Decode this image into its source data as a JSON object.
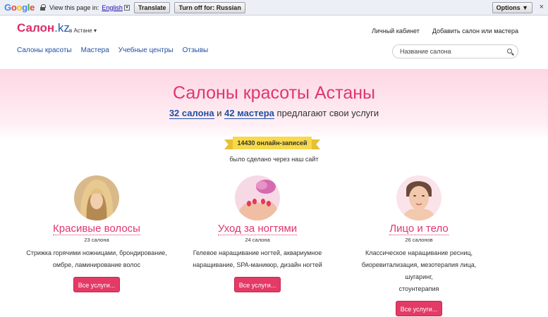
{
  "translate_bar": {
    "logo": "Google",
    "text": "View this page in:",
    "language": "English",
    "translate_label": "Translate",
    "turn_off_label": "Turn off for: Russian",
    "options_label": "Options ▼",
    "close": "×"
  },
  "header": {
    "logo_main": "Салон",
    "logo_domain": ".kz",
    "city": "в Астане",
    "city_arrow": "▾",
    "links": [
      "Личный кабинет",
      "Добавить салон или мастера"
    ],
    "nav": [
      "Салоны красоты",
      "Мастера",
      "Учебные центры",
      "Отзывы"
    ],
    "search_placeholder": "Название салона"
  },
  "hero": {
    "title": "Салоны красоты Астаны",
    "salons_link": "32 салона",
    "and": "и",
    "masters_link": "42 мастера",
    "suffix": "предлагают свои услуги",
    "ribbon": "14430 онлайн-записей",
    "done_text": "было сделано через наш сайт"
  },
  "categories": [
    {
      "title": "Красивые волосы",
      "count": "23 салона",
      "desc1": "Стрижка горячими ножницами, брондирование,",
      "desc2": "омбре, ламинирование волос",
      "desc3": "",
      "button": "Все услуги..."
    },
    {
      "title": "Уход за ногтями",
      "count": "24 салона",
      "desc1": "Гелевое наращивание ногтей, аквариумное",
      "desc2": "наращивание, SPA-маникюр, дизайн ногтей",
      "desc3": "",
      "button": "Все услуги..."
    },
    {
      "title": "Лицо и тело",
      "count": "26 салонов",
      "desc1": "Классическое наращивание ресниц,",
      "desc2": "биоревитализация, мезотерапия лица, шугаринг,",
      "desc3": "стоунтерапия",
      "button": "Все услуги..."
    }
  ],
  "colors": {
    "accent": "#e0356e",
    "link": "#1f4fa3",
    "ribbon": "#f7d94a",
    "button": "#e43a66"
  }
}
